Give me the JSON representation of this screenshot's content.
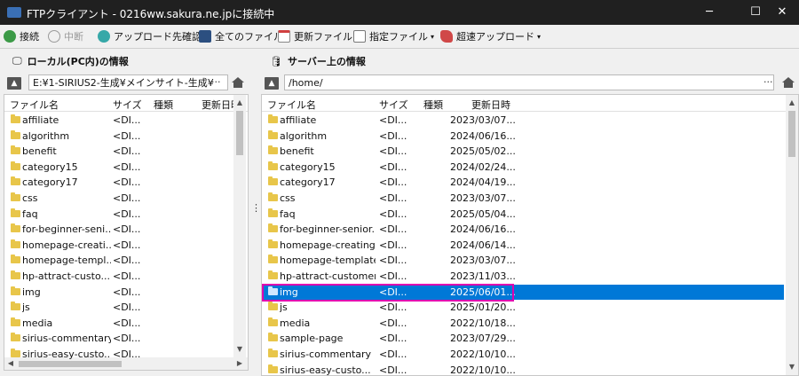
{
  "window": {
    "title": "FTPクライアント - 0216ww.sakura.ne.jpに接続中"
  },
  "window_buttons": {
    "minimize": "─",
    "maximize": "☐",
    "close": "✕"
  },
  "toolbar": {
    "connect": "接続",
    "abort": "中断",
    "check_upload_dest": "アップロード先確認",
    "all_files": "全てのファイル",
    "updated_files": "更新ファイル",
    "specified_files": "指定ファイル",
    "fast_upload": "超速アップロード"
  },
  "local": {
    "title": "ローカル(PC内)の情報",
    "path": "E:¥1-SIRIUS2-生成¥メインサイト-生成¥",
    "columns": [
      "ファイル名",
      "サイズ",
      "種類",
      "更新日時"
    ],
    "rows": [
      {
        "name": "affiliate",
        "size": "<DI..."
      },
      {
        "name": "algorithm",
        "size": "<DI..."
      },
      {
        "name": "benefit",
        "size": "<DI..."
      },
      {
        "name": "category15",
        "size": "<DI..."
      },
      {
        "name": "category17",
        "size": "<DI..."
      },
      {
        "name": "css",
        "size": "<DI..."
      },
      {
        "name": "faq",
        "size": "<DI..."
      },
      {
        "name": "for-beginner-seni...",
        "size": "<DI..."
      },
      {
        "name": "homepage-creati...",
        "size": "<DI..."
      },
      {
        "name": "homepage-templ...",
        "size": "<DI..."
      },
      {
        "name": "hp-attract-custo...",
        "size": "<DI..."
      },
      {
        "name": "img",
        "size": "<DI..."
      },
      {
        "name": "js",
        "size": "<DI..."
      },
      {
        "name": "media",
        "size": "<DI..."
      },
      {
        "name": "sirius-commentary",
        "size": "<DI..."
      },
      {
        "name": "sirius-easy-custo...",
        "size": "<DI..."
      }
    ]
  },
  "server": {
    "title": "サーバー上の情報",
    "path": "/home/",
    "columns": [
      "ファイル名",
      "サイズ",
      "種類",
      "更新日時"
    ],
    "rows": [
      {
        "name": "affiliate",
        "size": "<DI...",
        "date": "2023/03/07..."
      },
      {
        "name": "algorithm",
        "size": "<DI...",
        "date": "2024/06/16..."
      },
      {
        "name": "benefit",
        "size": "<DI...",
        "date": "2025/05/02..."
      },
      {
        "name": "category15",
        "size": "<DI...",
        "date": "2024/02/24..."
      },
      {
        "name": "category17",
        "size": "<DI...",
        "date": "2024/04/19..."
      },
      {
        "name": "css",
        "size": "<DI...",
        "date": "2023/03/07..."
      },
      {
        "name": "faq",
        "size": "<DI...",
        "date": "2025/05/04..."
      },
      {
        "name": "for-beginner-senior...",
        "size": "<DI...",
        "date": "2024/06/16..."
      },
      {
        "name": "homepage-creating",
        "size": "<DI...",
        "date": "2024/06/14..."
      },
      {
        "name": "homepage-template",
        "size": "<DI...",
        "date": "2023/03/07..."
      },
      {
        "name": "hp-attract-customers",
        "size": "<DI...",
        "date": "2023/11/03..."
      },
      {
        "name": "img",
        "size": "<DI...",
        "date": "2025/06/01...",
        "selected": true
      },
      {
        "name": "js",
        "size": "<DI...",
        "date": "2025/01/20..."
      },
      {
        "name": "media",
        "size": "<DI...",
        "date": "2022/10/18..."
      },
      {
        "name": "sample-page",
        "size": "<DI...",
        "date": "2023/07/29..."
      },
      {
        "name": "sirius-commentary",
        "size": "<DI...",
        "date": "2022/10/10..."
      },
      {
        "name": "sirius-easy-custo...",
        "size": "<DI...",
        "date": "2022/10/10..."
      }
    ]
  },
  "colors": {
    "selection": "#0078d7",
    "highlight": "#e000b0",
    "folder": "#e8c64a",
    "titlebar": "#202020"
  },
  "icons": {
    "connect": "link-icon",
    "abort": "no-entry-icon",
    "check": "check-cloud-icon",
    "all_files": "folder-save-icon",
    "updated_files": "calendar-icon",
    "specified_files": "document-icon",
    "fast_upload": "rocket-icon",
    "local": "monitor-icon",
    "server": "database-icon",
    "home": "home-icon",
    "folder": "folder-icon"
  }
}
